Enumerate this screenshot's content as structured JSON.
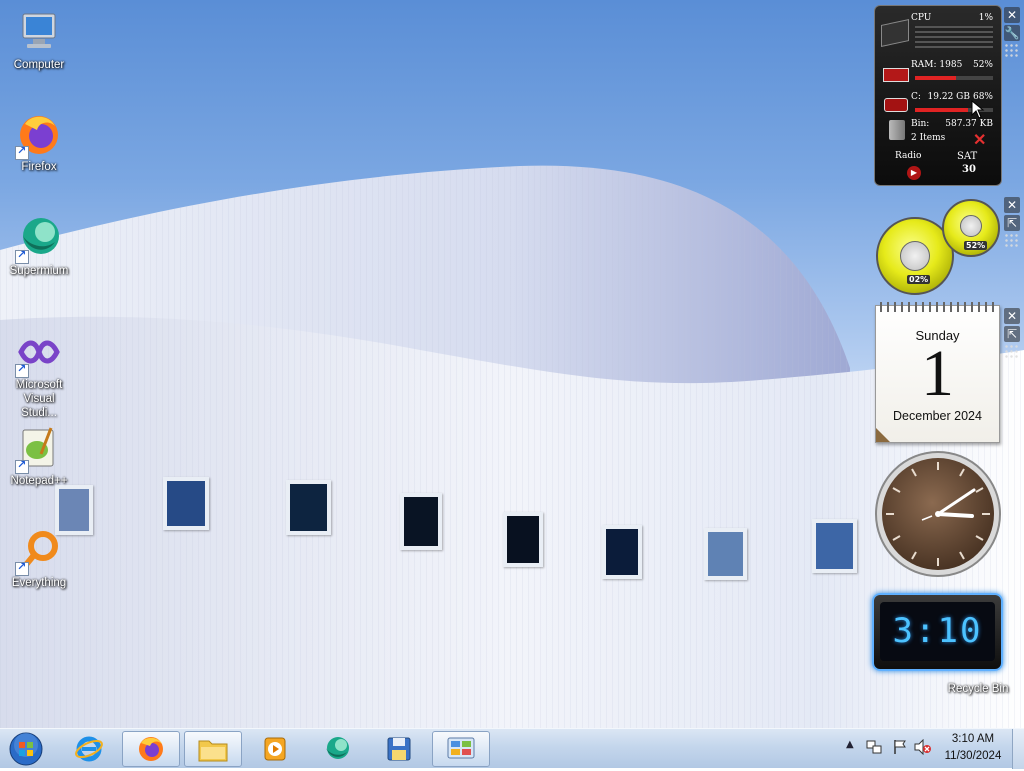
{
  "desktop_icons": [
    {
      "label": "Computer"
    },
    {
      "label": "Firefox"
    },
    {
      "label": "Supermium"
    },
    {
      "label": "Microsoft Visual Studi..."
    },
    {
      "label": "Notepad++"
    },
    {
      "label": "Everything"
    }
  ],
  "system_monitor": {
    "cpu_label": "CPU",
    "cpu_pct": "1%",
    "ram_label": "RAM: 1985",
    "ram_pct": "52%",
    "drive_label": "C:",
    "drive_size": "19.22 GB",
    "drive_pct": "68%",
    "bin_label": "Bin:",
    "bin_size": "587.37 KB",
    "bin_items": "2 Items",
    "radio_label": "Radio",
    "day_abbr": "SAT",
    "day_num": "30",
    "ram_fill": 0.52,
    "drive_fill": 0.68
  },
  "meters": {
    "cpu_pct": "02%",
    "ram_pct": "52%"
  },
  "calendar": {
    "weekday": "Sunday",
    "day": "1",
    "month_year": "December 2024"
  },
  "digital_clock": {
    "time": "3:10"
  },
  "recycle_bin": {
    "label": "Recycle Bin"
  },
  "taskbar": {
    "apps": [
      "Internet Explorer",
      "Firefox",
      "Windows Explorer",
      "Windows Media Player",
      "Supermium",
      "Save",
      "Control Panel"
    ],
    "tray_time": "3:10 AM",
    "tray_date": "11/30/2024"
  },
  "colors": {
    "gadget_bar": "#e02323",
    "digital_glow": "#4cc2ff"
  }
}
